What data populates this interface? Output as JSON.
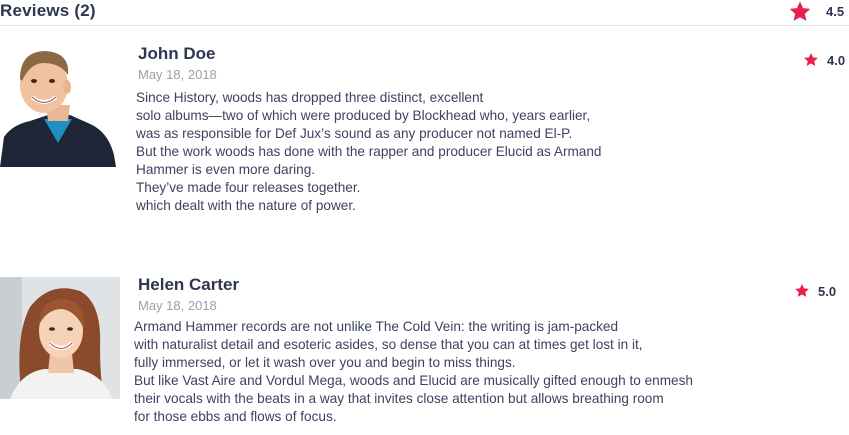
{
  "header": {
    "title": "Reviews (2)",
    "overall_rating": "4.5",
    "star_icon": "star-icon",
    "accent_color": "#e8204f"
  },
  "reviews": [
    {
      "name": "John Doe",
      "date": "May 18, 2018",
      "rating": "4.0",
      "avatar": "avatar-john-doe",
      "body": [
        "Since History, woods has dropped three distinct, excellent",
        "solo albums—two of which were produced by Blockhead who, years earlier,",
        "was as responsible for Def Jux’s sound as any producer not named El-P.",
        "But the work woods has done with the rapper and producer Elucid as Armand",
        "Hammer is even more daring.",
        "They’ve made four releases together.",
        "which dealt with the nature of power."
      ]
    },
    {
      "name": "Helen Carter",
      "date": "May 18, 2018",
      "rating": "5.0",
      "avatar": "avatar-helen-carter",
      "body": [
        "Armand Hammer records are not unlike The Cold Vein: the writing is jam-packed",
        "with naturalist detail and esoteric asides, so dense that you can at times get lost in it,",
        "fully immersed, or let it wash over you and begin to miss things.",
        "But like Vast Aire and Vordul Mega, woods and Elucid are musically gifted enough to enmesh",
        "their vocals with the beats in a way that invites close attention but allows breathing room",
        "for those ebbs and flows of focus."
      ]
    }
  ]
}
